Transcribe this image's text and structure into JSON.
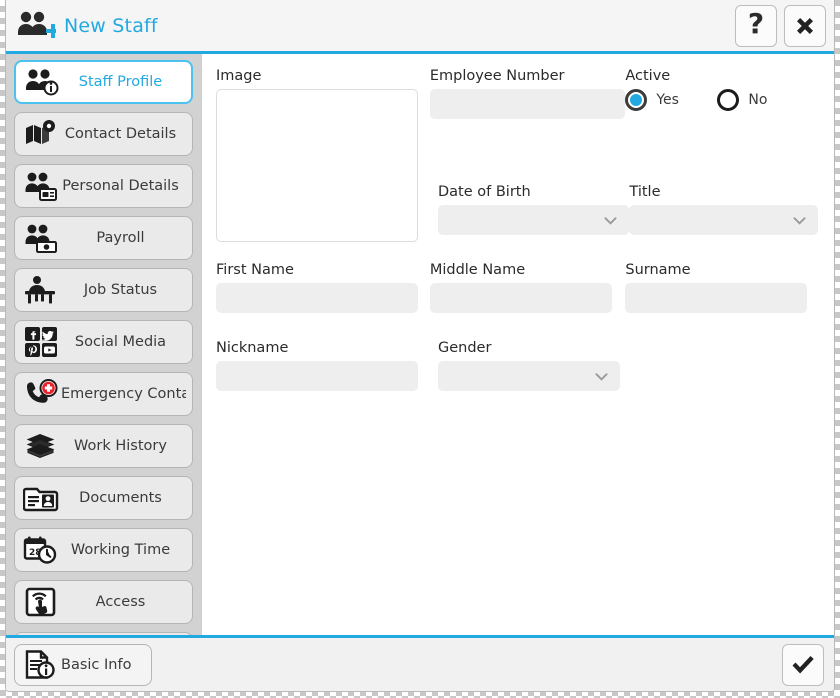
{
  "window": {
    "title": "New Staff",
    "title_icon": "add-staff-icon",
    "accent_color": "#22a9e0",
    "help_label": "?",
    "close_label": "✕"
  },
  "sidebar": {
    "items": [
      {
        "label": "Staff Profile",
        "icon": "staff-profile-icon",
        "selected": true
      },
      {
        "label": "Contact Details",
        "icon": "contact-details-icon",
        "selected": false
      },
      {
        "label": "Personal Details",
        "icon": "personal-details-icon",
        "selected": false
      },
      {
        "label": "Payroll",
        "icon": "payroll-icon",
        "selected": false
      },
      {
        "label": "Job Status",
        "icon": "job-status-icon",
        "selected": false
      },
      {
        "label": "Social Media",
        "icon": "social-media-icon",
        "selected": false
      },
      {
        "label": "Emergency Contact",
        "icon": "emergency-contact-icon",
        "selected": false
      },
      {
        "label": "Work History",
        "icon": "work-history-icon",
        "selected": false
      },
      {
        "label": "Documents",
        "icon": "documents-icon",
        "selected": false
      },
      {
        "label": "Working Time",
        "icon": "working-time-icon",
        "selected": false
      },
      {
        "label": "Access",
        "icon": "access-icon",
        "selected": false
      },
      {
        "label": "",
        "icon": "more-icon",
        "selected": false
      }
    ]
  },
  "form": {
    "image": {
      "label": "Image",
      "value": ""
    },
    "employee_number": {
      "label": "Employee Number",
      "value": "",
      "placeholder": ""
    },
    "active": {
      "label": "Active",
      "selected": "Yes",
      "options": [
        {
          "label": "Yes",
          "checked": true
        },
        {
          "label": "No",
          "checked": false
        }
      ]
    },
    "date_of_birth": {
      "label": "Date of Birth",
      "value": ""
    },
    "title": {
      "label": "Title",
      "value": ""
    },
    "first_name": {
      "label": "First Name",
      "value": "",
      "placeholder": ""
    },
    "middle_name": {
      "label": "Middle Name",
      "value": "",
      "placeholder": ""
    },
    "surname": {
      "label": "Surname",
      "value": "",
      "placeholder": ""
    },
    "nickname": {
      "label": "Nickname",
      "value": "",
      "placeholder": ""
    },
    "gender": {
      "label": "Gender",
      "value": ""
    }
  },
  "footer": {
    "basic_info": {
      "label": "Basic Info",
      "icon": "basic-info-icon"
    },
    "confirm": {
      "icon": "check-icon"
    }
  }
}
